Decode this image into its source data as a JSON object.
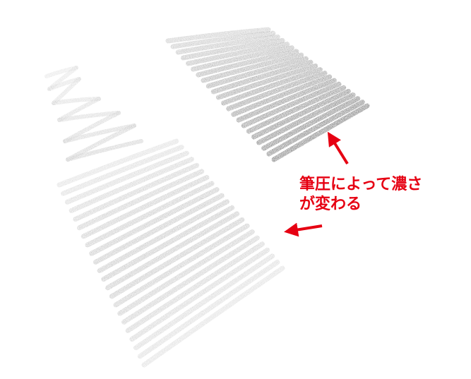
{
  "annotation": {
    "text": "筆圧によって濃さ\nが変わる",
    "color": "#e60012"
  },
  "illustration": {
    "description_icon": "pencil-pressure-strokes",
    "dark_stroke_color": "#2a2a2a",
    "light_stroke_color": "#9a9a9a"
  }
}
